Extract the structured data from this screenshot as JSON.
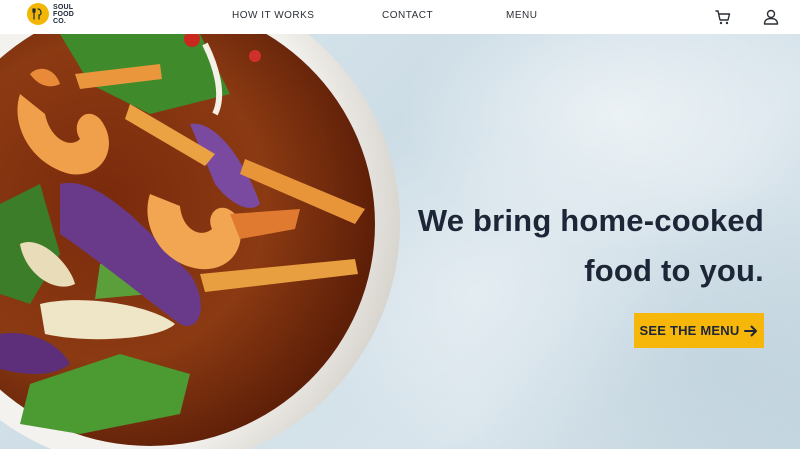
{
  "brand": {
    "logo_text": "SOUL\nFOOD\nCO.",
    "accent": "#f6b70a",
    "dark": "#1d2636"
  },
  "nav": {
    "items": [
      {
        "label": "HOW IT WORKS"
      },
      {
        "label": "CONTACT"
      },
      {
        "label": "MENU"
      }
    ],
    "icons": [
      "cart-icon",
      "user-icon"
    ]
  },
  "hero": {
    "headline_line1": "We bring home-cooked",
    "headline_line2": "food to you.",
    "cta_label": "SEE THE MENU",
    "cta_icon": "arrow-right-icon"
  }
}
